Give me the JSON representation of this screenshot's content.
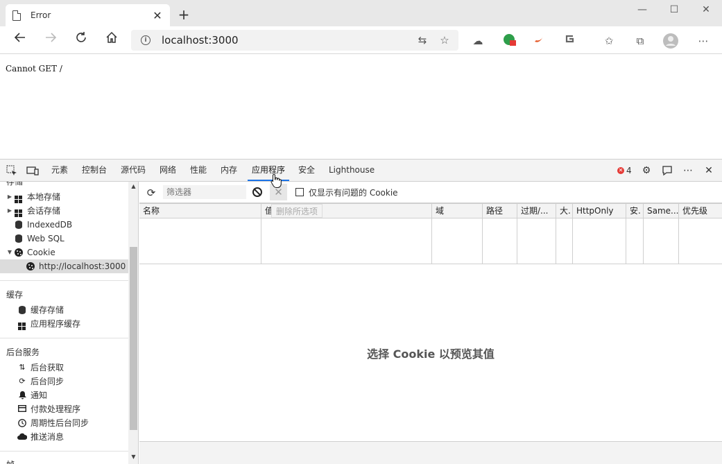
{
  "browser": {
    "tab_title": "Error",
    "tab_close": "✕",
    "new_tab": "+",
    "url": "localhost:3000",
    "window_controls": [
      "—",
      "☐",
      "✕"
    ]
  },
  "page": {
    "body_text": "Cannot GET /"
  },
  "devtools": {
    "tabs": [
      "元素",
      "控制台",
      "源代码",
      "网络",
      "性能",
      "内存",
      "应用程序",
      "安全",
      "Lighthouse"
    ],
    "active_tab": "应用程序",
    "error_count": "4",
    "sidebar": {
      "storage_heading": "存储",
      "storage_items": [
        "本地存储",
        "会话存储",
        "IndexedDB",
        "Web SQL",
        "Cookie"
      ],
      "cookie_child": "http://localhost:3000",
      "cache_heading": "缓存",
      "cache_items": [
        "缓存存储",
        "应用程序缓存"
      ],
      "background_heading": "后台服务",
      "background_items": [
        "后台获取",
        "后台同步",
        "通知",
        "付款处理程序",
        "周期性后台同步",
        "推送消息"
      ],
      "frames_heading": "帧"
    },
    "filter_placeholder": "筛选器",
    "only_issues_label": "仅显示有问题的 Cookie",
    "delete_selected_tooltip": "删除所选项",
    "columns": [
      "名称",
      "值",
      "域",
      "路径",
      "过期/...",
      "大.",
      "HttpOnly",
      "安.",
      "Same...",
      "优先级"
    ],
    "preview_message": "选择 Cookie 以预览其值"
  },
  "colors": {
    "accent": "#1a73e8",
    "error": "#e53935"
  }
}
